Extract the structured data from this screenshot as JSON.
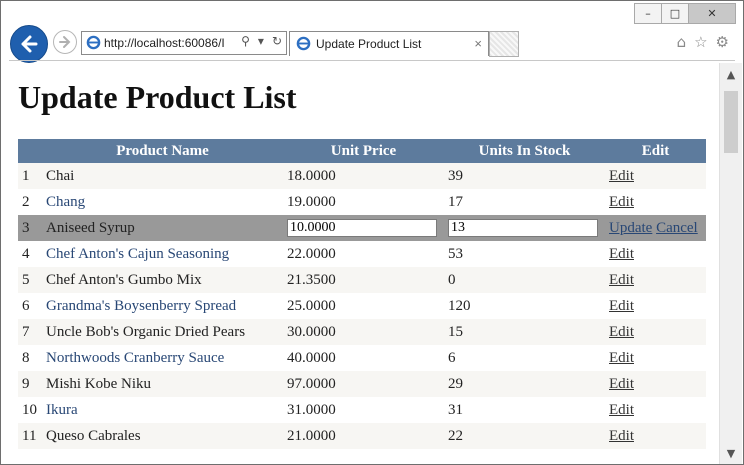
{
  "browser": {
    "address": "http://localhost:60086/I",
    "tab_title": "Update Product List",
    "tab_close": "×",
    "controls": {
      "minimize": "–",
      "maximize": "□",
      "close": "✕"
    }
  },
  "page": {
    "title": "Update Product List",
    "columns": [
      "Product Name",
      "Unit Price",
      "Units In Stock",
      "Edit"
    ],
    "rows": [
      {
        "n": "1",
        "name": "Chai",
        "price": "18.0000",
        "stock": "39",
        "edit": "Edit"
      },
      {
        "n": "2",
        "name": "Chang",
        "price": "19.0000",
        "stock": "17",
        "edit": "Edit"
      },
      {
        "n": "3",
        "name": "Aniseed Syrup",
        "price": "10.0000",
        "stock": "13",
        "update": "Update",
        "cancel": "Cancel"
      },
      {
        "n": "4",
        "name": "Chef Anton's Cajun Seasoning",
        "price": "22.0000",
        "stock": "53",
        "edit": "Edit"
      },
      {
        "n": "5",
        "name": "Chef Anton's Gumbo Mix",
        "price": "21.3500",
        "stock": "0",
        "edit": "Edit"
      },
      {
        "n": "6",
        "name": "Grandma's Boysenberry Spread",
        "price": "25.0000",
        "stock": "120",
        "edit": "Edit"
      },
      {
        "n": "7",
        "name": "Uncle Bob's Organic Dried Pears",
        "price": "30.0000",
        "stock": "15",
        "edit": "Edit"
      },
      {
        "n": "8",
        "name": "Northwoods Cranberry Sauce",
        "price": "40.0000",
        "stock": "6",
        "edit": "Edit"
      },
      {
        "n": "9",
        "name": "Mishi Kobe Niku",
        "price": "97.0000",
        "stock": "29",
        "edit": "Edit"
      },
      {
        "n": "10",
        "name": "Ikura",
        "price": "31.0000",
        "stock": "31",
        "edit": "Edit"
      },
      {
        "n": "11",
        "name": "Queso Cabrales",
        "price": "21.0000",
        "stock": "22",
        "edit": "Edit"
      }
    ]
  },
  "colors": {
    "header_bg": "#5d7b9d",
    "alt_row": "#f7f6f3",
    "edit_row": "#999999",
    "link": "#284775"
  },
  "icons": [
    "back-arrow-icon",
    "forward-arrow-icon",
    "ie-favicon-icon",
    "search-icon",
    "dropdown-icon",
    "refresh-icon",
    "home-icon",
    "favorites-star-icon",
    "settings-gear-icon"
  ]
}
